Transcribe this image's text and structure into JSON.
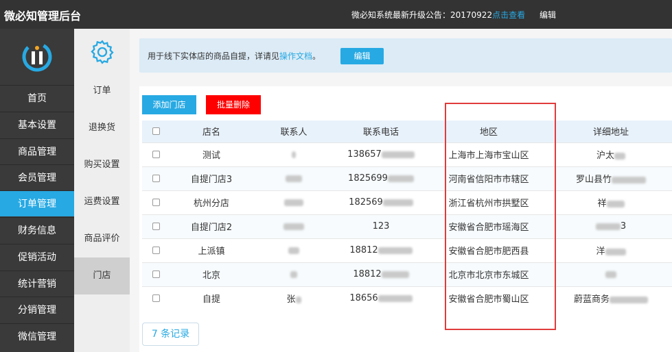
{
  "header": {
    "title": "微必知管理后台",
    "notice_prefix": "微必知系统最新升级公告：20170922",
    "notice_link": "点击查看",
    "edit": "编辑"
  },
  "sidebar": {
    "items": [
      {
        "label": "首页"
      },
      {
        "label": "基本设置"
      },
      {
        "label": "商品管理"
      },
      {
        "label": "会员管理"
      },
      {
        "label": "订单管理",
        "active": true
      },
      {
        "label": "财务信息"
      },
      {
        "label": "促销活动"
      },
      {
        "label": "统计营销"
      },
      {
        "label": "分销管理"
      },
      {
        "label": "微信管理"
      }
    ]
  },
  "subnav": {
    "items": [
      {
        "label": "订单"
      },
      {
        "label": "退换货"
      },
      {
        "label": "购买设置"
      },
      {
        "label": "运费设置"
      },
      {
        "label": "商品评价"
      },
      {
        "label": "门店",
        "active": true
      }
    ]
  },
  "info": {
    "text_prefix": "用于线下实体店的商品自提，详请见",
    "doc_link": "操作文档",
    "text_suffix": "。",
    "edit_button": "编辑"
  },
  "toolbar": {
    "add_label": "添加门店",
    "delete_label": "批量删除"
  },
  "table": {
    "columns": [
      "店名",
      "联系人",
      "联系电话",
      "地区",
      "详细地址"
    ],
    "rows": [
      {
        "name": "测试",
        "contact": "",
        "phone": "138657",
        "region": "上海市上海市宝山区",
        "address": "沪太"
      },
      {
        "name": "自提门店3",
        "contact": "",
        "phone": "1825699",
        "region": "河南省信阳市市辖区",
        "address": "罗山县竹"
      },
      {
        "name": "杭州分店",
        "contact": "",
        "phone": "182569",
        "region": "浙江省杭州市拱墅区",
        "address": "祥"
      },
      {
        "name": "自提门店2",
        "contact": "",
        "phone": "123",
        "region": "安徽省合肥市瑶海区",
        "address": "3"
      },
      {
        "name": "上派镇",
        "contact": "",
        "phone": "18812",
        "region": "安徽省合肥市肥西县",
        "address": "洋"
      },
      {
        "name": "北京",
        "contact": "",
        "phone": "18812",
        "region": "北京市北京市东城区",
        "address": ""
      },
      {
        "name": "自提",
        "contact": "张",
        "phone": "18656",
        "region": "安徽省合肥市蜀山区",
        "address": "蔚蓝商务"
      }
    ]
  },
  "records": "7 条记录",
  "colors": {
    "accent": "#27a9e3",
    "danger": "#ff0000",
    "topbar": "#333333",
    "sidebar": "#3a3a3a"
  }
}
